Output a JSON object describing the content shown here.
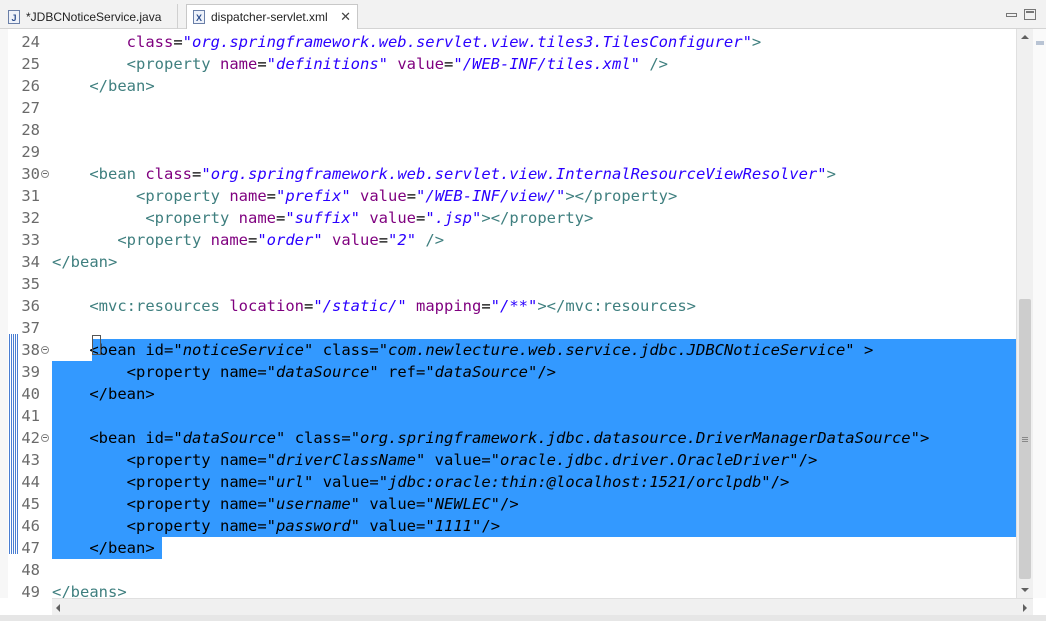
{
  "tabs": [
    {
      "label": "*JDBCNoticeService.java",
      "icon": "java-file-icon",
      "icon_glyph": "J"
    },
    {
      "label": "dispatcher-servlet.xml",
      "icon": "xml-file-icon",
      "icon_glyph": "X",
      "close": "✕"
    }
  ],
  "colors": {
    "tag": "#3f7f7f",
    "attribute": "#7f007f",
    "value": "#2a00ff",
    "selection": "#3399ff"
  },
  "editor": {
    "lines": [
      {
        "num": "24",
        "segments": [
          {
            "t": "        "
          },
          {
            "t": "class",
            "c": "a"
          },
          {
            "t": "="
          },
          {
            "t": "\"org.springframework.web.servlet.view.tiles3.TilesConfigurer\"",
            "c": "v"
          },
          {
            "t": ">",
            "c": "t"
          }
        ]
      },
      {
        "num": "25",
        "segments": [
          {
            "t": "        "
          },
          {
            "t": "<property",
            "c": "t"
          },
          {
            "t": " "
          },
          {
            "t": "name",
            "c": "a"
          },
          {
            "t": "="
          },
          {
            "t": "\"definitions\"",
            "c": "v"
          },
          {
            "t": " "
          },
          {
            "t": "value",
            "c": "a"
          },
          {
            "t": "="
          },
          {
            "t": "\"/WEB-INF/tiles.xml\"",
            "c": "v"
          },
          {
            "t": " "
          },
          {
            "t": "/>",
            "c": "t"
          }
        ]
      },
      {
        "num": "26",
        "segments": [
          {
            "t": "    "
          },
          {
            "t": "</bean>",
            "c": "t"
          }
        ]
      },
      {
        "num": "27",
        "segments": []
      },
      {
        "num": "28",
        "segments": []
      },
      {
        "num": "29",
        "segments": []
      },
      {
        "num": "30",
        "fold": true,
        "segments": [
          {
            "t": "    "
          },
          {
            "t": "<bean",
            "c": "t"
          },
          {
            "t": " "
          },
          {
            "t": "class",
            "c": "a"
          },
          {
            "t": "="
          },
          {
            "t": "\"org.springframework.web.servlet.view.InternalResourceViewResolver\"",
            "c": "v"
          },
          {
            "t": ">",
            "c": "t"
          }
        ]
      },
      {
        "num": "31",
        "segments": [
          {
            "t": "         "
          },
          {
            "t": "<property",
            "c": "t"
          },
          {
            "t": " "
          },
          {
            "t": "name",
            "c": "a"
          },
          {
            "t": "="
          },
          {
            "t": "\"prefix\"",
            "c": "v"
          },
          {
            "t": " "
          },
          {
            "t": "value",
            "c": "a"
          },
          {
            "t": "="
          },
          {
            "t": "\"/WEB-INF/view/\"",
            "c": "v"
          },
          {
            "t": "></property>",
            "c": "t"
          }
        ]
      },
      {
        "num": "32",
        "segments": [
          {
            "t": "          "
          },
          {
            "t": "<property",
            "c": "t"
          },
          {
            "t": " "
          },
          {
            "t": "name",
            "c": "a"
          },
          {
            "t": "="
          },
          {
            "t": "\"suffix\"",
            "c": "v"
          },
          {
            "t": " "
          },
          {
            "t": "value",
            "c": "a"
          },
          {
            "t": "="
          },
          {
            "t": "\".jsp\"",
            "c": "v"
          },
          {
            "t": "></property>",
            "c": "t"
          }
        ]
      },
      {
        "num": "33",
        "segments": [
          {
            "t": "       "
          },
          {
            "t": "<property",
            "c": "t"
          },
          {
            "t": " "
          },
          {
            "t": "name",
            "c": "a"
          },
          {
            "t": "="
          },
          {
            "t": "\"order\"",
            "c": "v"
          },
          {
            "t": " "
          },
          {
            "t": "value",
            "c": "a"
          },
          {
            "t": "="
          },
          {
            "t": "\"2\"",
            "c": "v"
          },
          {
            "t": " "
          },
          {
            "t": "/>",
            "c": "t"
          }
        ]
      },
      {
        "num": "34",
        "segments": [
          {
            "t": "</bean>",
            "c": "t"
          }
        ]
      },
      {
        "num": "35",
        "segments": []
      },
      {
        "num": "36",
        "segments": [
          {
            "t": "    "
          },
          {
            "t": "<mvc:resources",
            "c": "t"
          },
          {
            "t": " "
          },
          {
            "t": "location",
            "c": "a"
          },
          {
            "t": "="
          },
          {
            "t": "\"/static/\"",
            "c": "v"
          },
          {
            "t": " "
          },
          {
            "t": "mapping",
            "c": "a"
          },
          {
            "t": "="
          },
          {
            "t": "\"/**\"",
            "c": "v"
          },
          {
            "t": "></mvc:resources>",
            "c": "t"
          }
        ]
      },
      {
        "num": "37",
        "segments": []
      },
      {
        "num": "38",
        "fold": true,
        "selected": true,
        "segments": [
          {
            "t": "    "
          },
          {
            "t": "<bean",
            "c": "t"
          },
          {
            "t": " "
          },
          {
            "t": "id",
            "c": "a"
          },
          {
            "t": "="
          },
          {
            "t": "\"noticeService\"",
            "c": "v"
          },
          {
            "t": " "
          },
          {
            "t": "class",
            "c": "a"
          },
          {
            "t": "="
          },
          {
            "t": "\"com.newlecture.web.service.jdbc.JDBCNoticeService\"",
            "c": "v"
          },
          {
            "t": " "
          },
          {
            "t": ">",
            "c": "t"
          }
        ]
      },
      {
        "num": "39",
        "selected": true,
        "segments": [
          {
            "t": "        "
          },
          {
            "t": "<property",
            "c": "t"
          },
          {
            "t": " "
          },
          {
            "t": "name",
            "c": "a"
          },
          {
            "t": "="
          },
          {
            "t": "\"dataSource\"",
            "c": "v"
          },
          {
            "t": " "
          },
          {
            "t": "ref",
            "c": "a"
          },
          {
            "t": "="
          },
          {
            "t": "\"dataSource\"",
            "c": "v"
          },
          {
            "t": "/>",
            "c": "t"
          }
        ]
      },
      {
        "num": "40",
        "selected": true,
        "segments": [
          {
            "t": "    "
          },
          {
            "t": "</bean>",
            "c": "t"
          }
        ]
      },
      {
        "num": "41",
        "selected": true,
        "segments": []
      },
      {
        "num": "42",
        "fold": true,
        "selected": true,
        "segments": [
          {
            "t": "    "
          },
          {
            "t": "<bean",
            "c": "t"
          },
          {
            "t": " "
          },
          {
            "t": "id",
            "c": "a"
          },
          {
            "t": "="
          },
          {
            "t": "\"dataSource\"",
            "c": "v"
          },
          {
            "t": " "
          },
          {
            "t": "class",
            "c": "a"
          },
          {
            "t": "="
          },
          {
            "t": "\"org.springframework.jdbc.datasource.DriverManagerDataSource\"",
            "c": "v"
          },
          {
            "t": ">",
            "c": "t"
          }
        ]
      },
      {
        "num": "43",
        "selected": true,
        "segments": [
          {
            "t": "        "
          },
          {
            "t": "<property",
            "c": "t"
          },
          {
            "t": " "
          },
          {
            "t": "name",
            "c": "a"
          },
          {
            "t": "="
          },
          {
            "t": "\"driverClassName\"",
            "c": "v"
          },
          {
            "t": " "
          },
          {
            "t": "value",
            "c": "a"
          },
          {
            "t": "="
          },
          {
            "t": "\"oracle.jdbc.driver.OracleDriver\"",
            "c": "v"
          },
          {
            "t": "/>",
            "c": "t"
          }
        ]
      },
      {
        "num": "44",
        "selected": true,
        "segments": [
          {
            "t": "        "
          },
          {
            "t": "<property",
            "c": "t"
          },
          {
            "t": " "
          },
          {
            "t": "name",
            "c": "a"
          },
          {
            "t": "="
          },
          {
            "t": "\"url\"",
            "c": "v"
          },
          {
            "t": " "
          },
          {
            "t": "value",
            "c": "a"
          },
          {
            "t": "="
          },
          {
            "t": "\"jdbc:oracle:thin:@localhost:1521/orclpdb\"",
            "c": "v"
          },
          {
            "t": "/>",
            "c": "t"
          }
        ]
      },
      {
        "num": "45",
        "selected": true,
        "segments": [
          {
            "t": "        "
          },
          {
            "t": "<property",
            "c": "t"
          },
          {
            "t": " "
          },
          {
            "t": "name",
            "c": "a"
          },
          {
            "t": "="
          },
          {
            "t": "\"username\"",
            "c": "v"
          },
          {
            "t": " "
          },
          {
            "t": "value",
            "c": "a"
          },
          {
            "t": "="
          },
          {
            "t": "\"NEWLEC\"",
            "c": "v"
          },
          {
            "t": "/>",
            "c": "t"
          }
        ]
      },
      {
        "num": "46",
        "selected": true,
        "segments": [
          {
            "t": "        "
          },
          {
            "t": "<property",
            "c": "t"
          },
          {
            "t": " "
          },
          {
            "t": "name",
            "c": "a"
          },
          {
            "t": "="
          },
          {
            "t": "\"password\"",
            "c": "v"
          },
          {
            "t": " "
          },
          {
            "t": "value",
            "c": "a"
          },
          {
            "t": "="
          },
          {
            "t": "\"1111\"",
            "c": "v"
          },
          {
            "t": "/>",
            "c": "t"
          }
        ]
      },
      {
        "num": "47",
        "selected": true,
        "partial": true,
        "segments": [
          {
            "t": "    "
          },
          {
            "t": "</bean>",
            "c": "t"
          }
        ]
      },
      {
        "num": "48",
        "segments": []
      },
      {
        "num": "49",
        "segments": [
          {
            "t": "</beans>",
            "c": "t"
          }
        ]
      }
    ]
  }
}
